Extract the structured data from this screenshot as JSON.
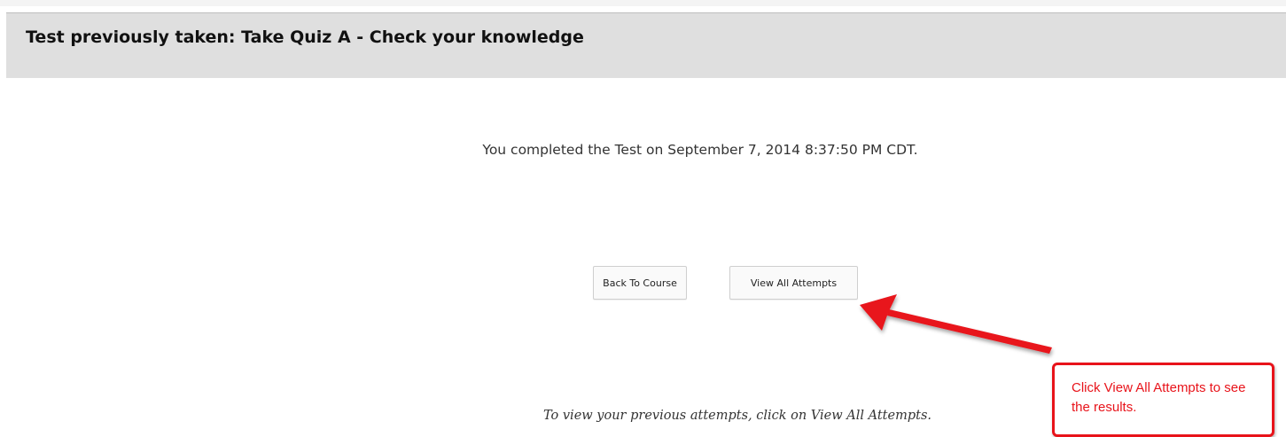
{
  "header": {
    "title": "Test previously taken: Take Quiz A - Check your knowledge"
  },
  "main": {
    "completion_message": "You completed the Test on September 7, 2014 8:37:50 PM CDT.",
    "buttons": {
      "back_to_course": "Back To Course",
      "view_all_attempts": "View All Attempts"
    },
    "instruction": "To view your previous attempts, click on View All Attempts."
  },
  "annotation": {
    "callout_text": "Click View All Attempts to see the results.",
    "color": "#e8131a"
  }
}
